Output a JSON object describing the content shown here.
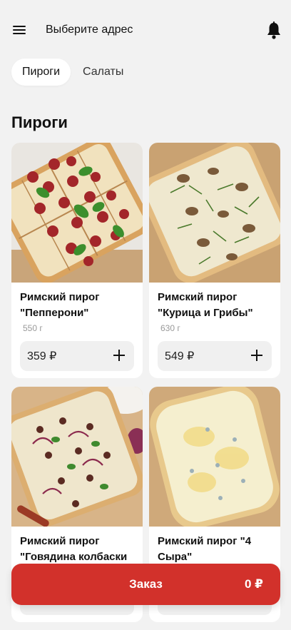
{
  "header": {
    "address_label": "Выберите адрес",
    "menu_icon": "hamburger-menu-icon",
    "notification_icon": "bell-icon"
  },
  "tabs": [
    {
      "label": "Пироги",
      "active": true
    },
    {
      "label": "Салаты",
      "active": false
    }
  ],
  "section": {
    "title": "Пироги"
  },
  "products": [
    {
      "name": "Римский пирог \"Пепперони\"",
      "weight": "550 г",
      "price": "359 ₽"
    },
    {
      "name": "Римский пирог \"Курица и Грибы\"",
      "weight": "630 г",
      "price": "549 ₽"
    },
    {
      "name": "Римский пирог \"Говядина колбаски",
      "weight": "",
      "price": ""
    },
    {
      "name": "Римский пирог \"4 Сыра\"",
      "weight": "",
      "price": ""
    }
  ],
  "order": {
    "label": "Заказ",
    "total": "0 ₽"
  },
  "colors": {
    "accent": "#d2312b",
    "background": "#f2f2f2",
    "card": "#ffffff"
  }
}
